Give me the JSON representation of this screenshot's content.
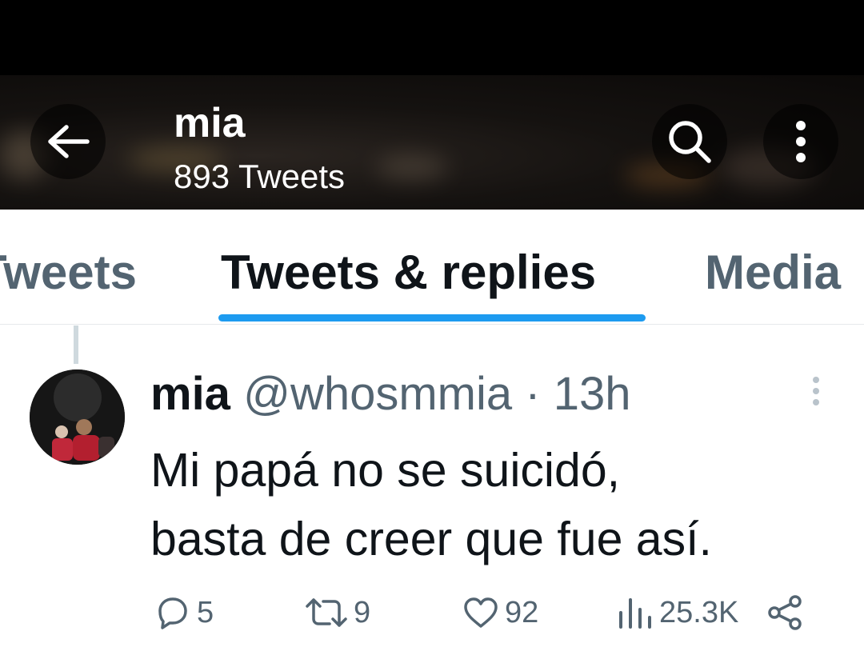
{
  "header": {
    "name": "mia",
    "tweet_count": "893 Tweets"
  },
  "tabs": [
    {
      "label": "Tweets",
      "active": false
    },
    {
      "label": "Tweets & replies",
      "active": true
    },
    {
      "label": "Media",
      "active": false
    }
  ],
  "tweet": {
    "name": "mia",
    "handle": "@whosmmia",
    "separator": "·",
    "time": "13h",
    "text_line1": "Mi papá no se suicidó,",
    "text_line2": "basta de creer que fue así.",
    "actions": {
      "replies": "5",
      "retweets": "9",
      "likes": "92",
      "views": "25.3K"
    }
  },
  "colors": {
    "accent": "#1d9bf0",
    "text_primary": "#0f1419",
    "text_secondary": "#536471"
  },
  "icons": [
    "back-arrow-icon",
    "search-icon",
    "more-vertical-icon",
    "reply-icon",
    "retweet-icon",
    "like-icon",
    "views-icon",
    "share-icon"
  ]
}
